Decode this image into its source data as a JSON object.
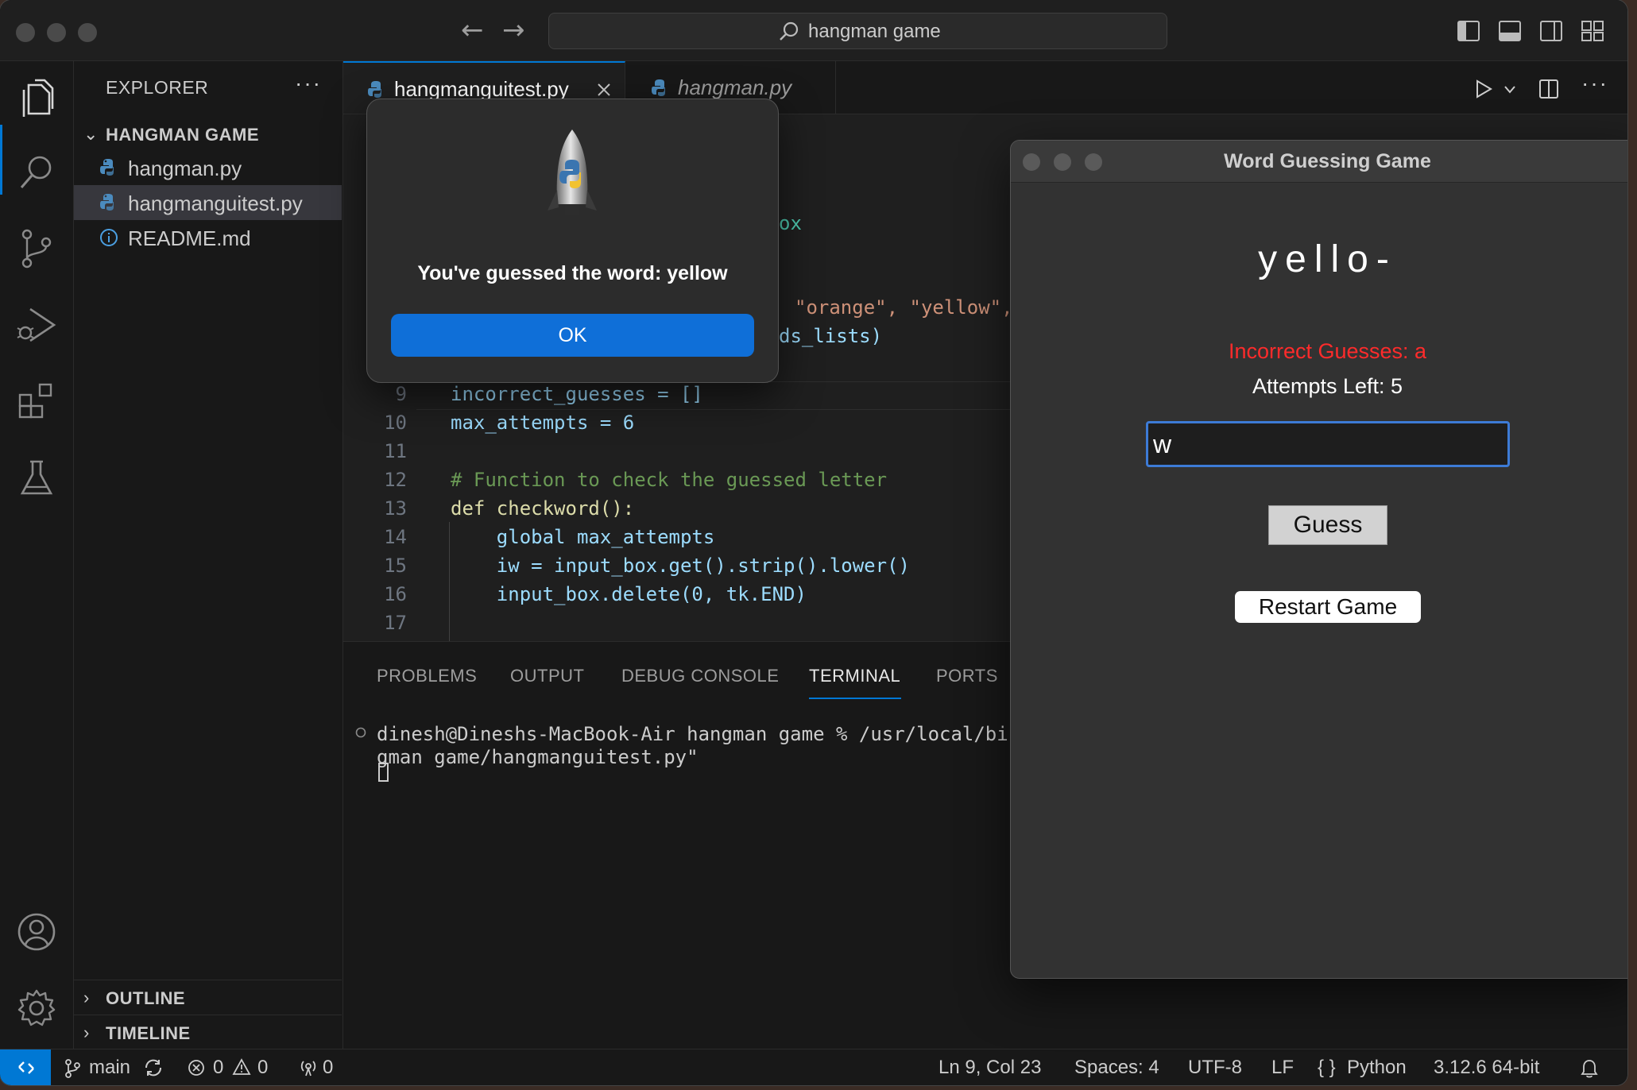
{
  "window": {
    "search_text": "hangman game"
  },
  "explorer": {
    "title": "EXPLORER",
    "more": "···",
    "folder": "HANGMAN GAME",
    "files": [
      {
        "name": "hangman.py",
        "icon": "python-file-icon"
      },
      {
        "name": "hangmanguitest.py",
        "icon": "python-file-icon",
        "selected": true
      },
      {
        "name": "README.md",
        "icon": "info-icon"
      }
    ],
    "outline": "OUTLINE",
    "timeline": "TIMELINE"
  },
  "tabs": [
    {
      "label": "hangmanguitest.py",
      "active": true
    },
    {
      "label": "hangman.py",
      "active": false
    }
  ],
  "code": {
    "partial_visible": [
      "ox",
      "\"orange\", \"yellow\",",
      "ds_lists)"
    ],
    "lines": [
      {
        "n": "9",
        "text": "incorrect_guesses = []"
      },
      {
        "n": "10",
        "text": "max_attempts = 6"
      },
      {
        "n": "11",
        "text": ""
      },
      {
        "n": "12",
        "text": "# Function to check the guessed letter"
      },
      {
        "n": "13",
        "text": "def checkword():"
      },
      {
        "n": "14",
        "text": "    global max_attempts"
      },
      {
        "n": "15",
        "text": "    iw = input_box.get().strip().lower()"
      },
      {
        "n": "16",
        "text": "    input_box.delete(0, tk.END)"
      },
      {
        "n": "17",
        "text": ""
      }
    ]
  },
  "panel": {
    "tabs": [
      "PROBLEMS",
      "OUTPUT",
      "DEBUG CONSOLE",
      "TERMINAL",
      "PORTS"
    ],
    "active_tab": "TERMINAL",
    "terminal_lines": [
      "dinesh@Dineshs-MacBook-Air hangman game % /usr/local/bin/",
      "gman game/hangmanguitest.py\""
    ]
  },
  "statusbar": {
    "branch": "main",
    "errors": "0",
    "warnings": "0",
    "ports": "0",
    "position": "Ln 9, Col 23",
    "spaces": "Spaces: 4",
    "encoding": "UTF-8",
    "eol": "LF",
    "language": "Python",
    "interpreter": "3.12.6 64-bit"
  },
  "dialog": {
    "message": "You've guessed the word: yellow",
    "ok_label": "OK"
  },
  "game": {
    "title": "Word Guessing Game",
    "word_display": "yello-",
    "incorrect_guesses": "Incorrect Guesses: a",
    "attempts_left": "Attempts Left: 5",
    "input_value": "w",
    "guess_label": "Guess",
    "restart_label": "Restart Game"
  },
  "colors": {
    "accent": "#0078d4",
    "incorrect": "#ff2b2b",
    "ok_button": "#0f6fd8"
  }
}
